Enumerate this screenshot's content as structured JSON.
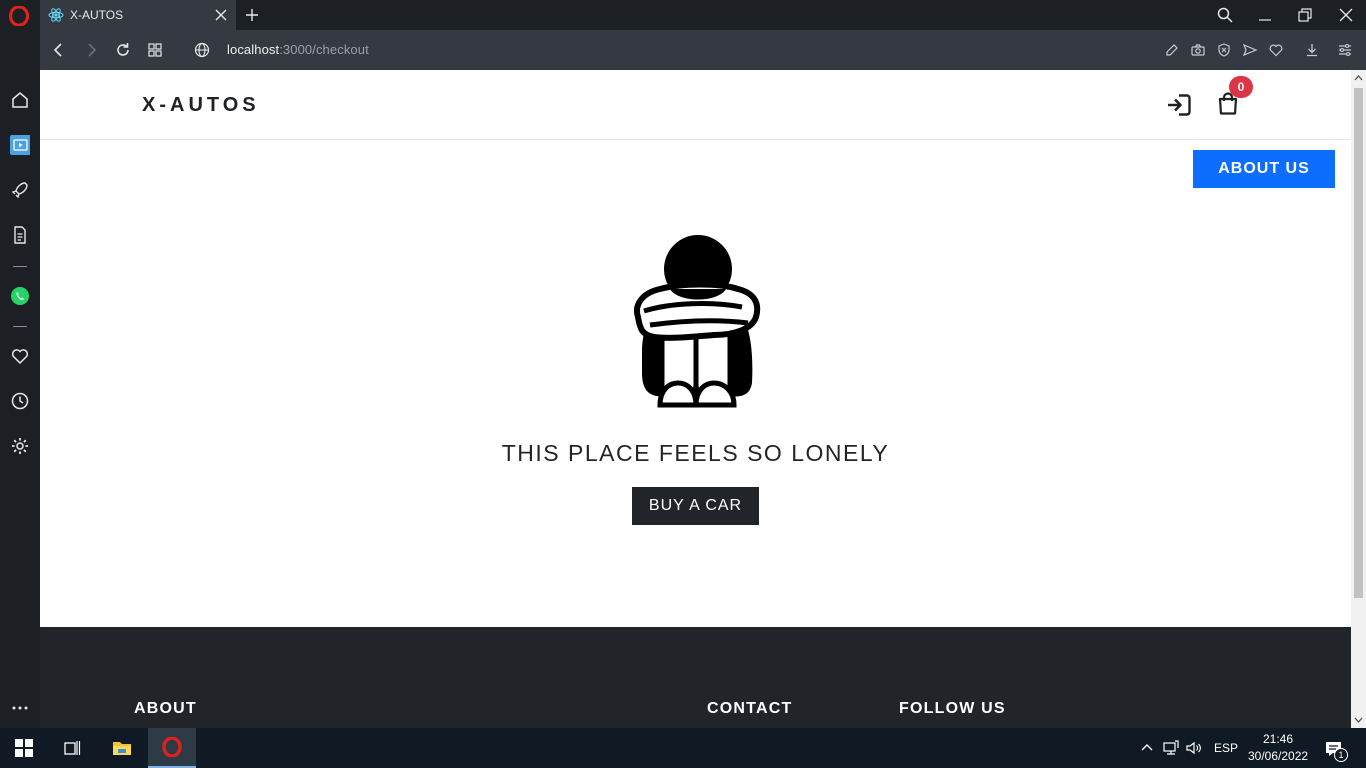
{
  "browser": {
    "tab_title": "X-AUTOS",
    "url_host": "localhost",
    "url_rest": ":3000/checkout"
  },
  "site": {
    "brand": "X-AUTOS",
    "cart_count": "0",
    "about_button": "ABOUT US",
    "empty_message": "THIS PLACE FEELS SO LONELY",
    "buy_button": "BUY A CAR",
    "footer": {
      "about_heading": "ABOUT",
      "contact_heading": "CONTACT",
      "follow_heading": "FOLLOW US"
    }
  },
  "taskbar": {
    "language": "ESP",
    "time": "21:46",
    "date": "30/06/2022",
    "notification_count": "1"
  },
  "colors": {
    "accent_blue": "#0d6efd",
    "badge_red": "#dc3545",
    "dark": "#212529"
  }
}
